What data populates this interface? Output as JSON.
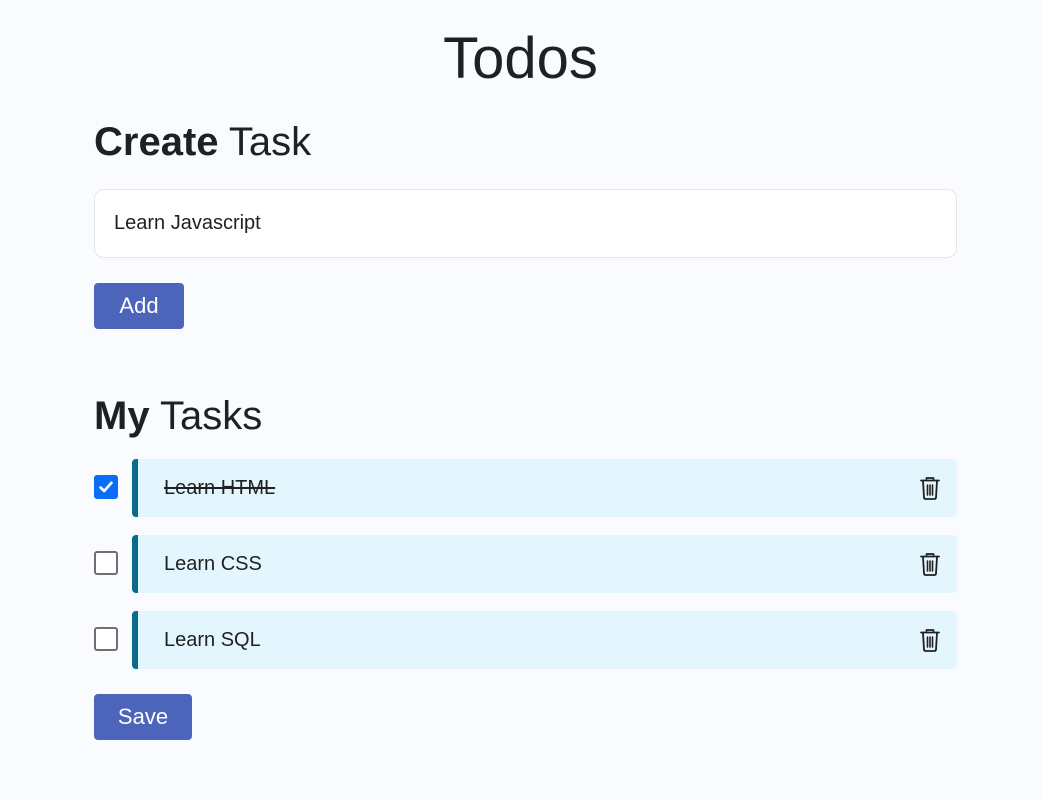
{
  "app": {
    "title": "Todos"
  },
  "create_section": {
    "heading_bold": "Create",
    "heading_rest": " Task",
    "input_value": "Learn Javascript",
    "add_label": "Add"
  },
  "tasks_section": {
    "heading_bold": "My",
    "heading_rest": " Tasks",
    "tasks": [
      {
        "label": "Learn HTML",
        "checked": true
      },
      {
        "label": "Learn CSS",
        "checked": false
      },
      {
        "label": "Learn SQL",
        "checked": false
      }
    ],
    "save_label": "Save"
  },
  "icons": {
    "delete": "trash-icon",
    "checkmark": "check-icon"
  },
  "colors": {
    "background": "#f9fbfe",
    "button": "#4d64bb",
    "task_card": "#e4f6fd",
    "task_accent": "#0a6b8a",
    "checkbox_checked": "#0b6cf5"
  }
}
